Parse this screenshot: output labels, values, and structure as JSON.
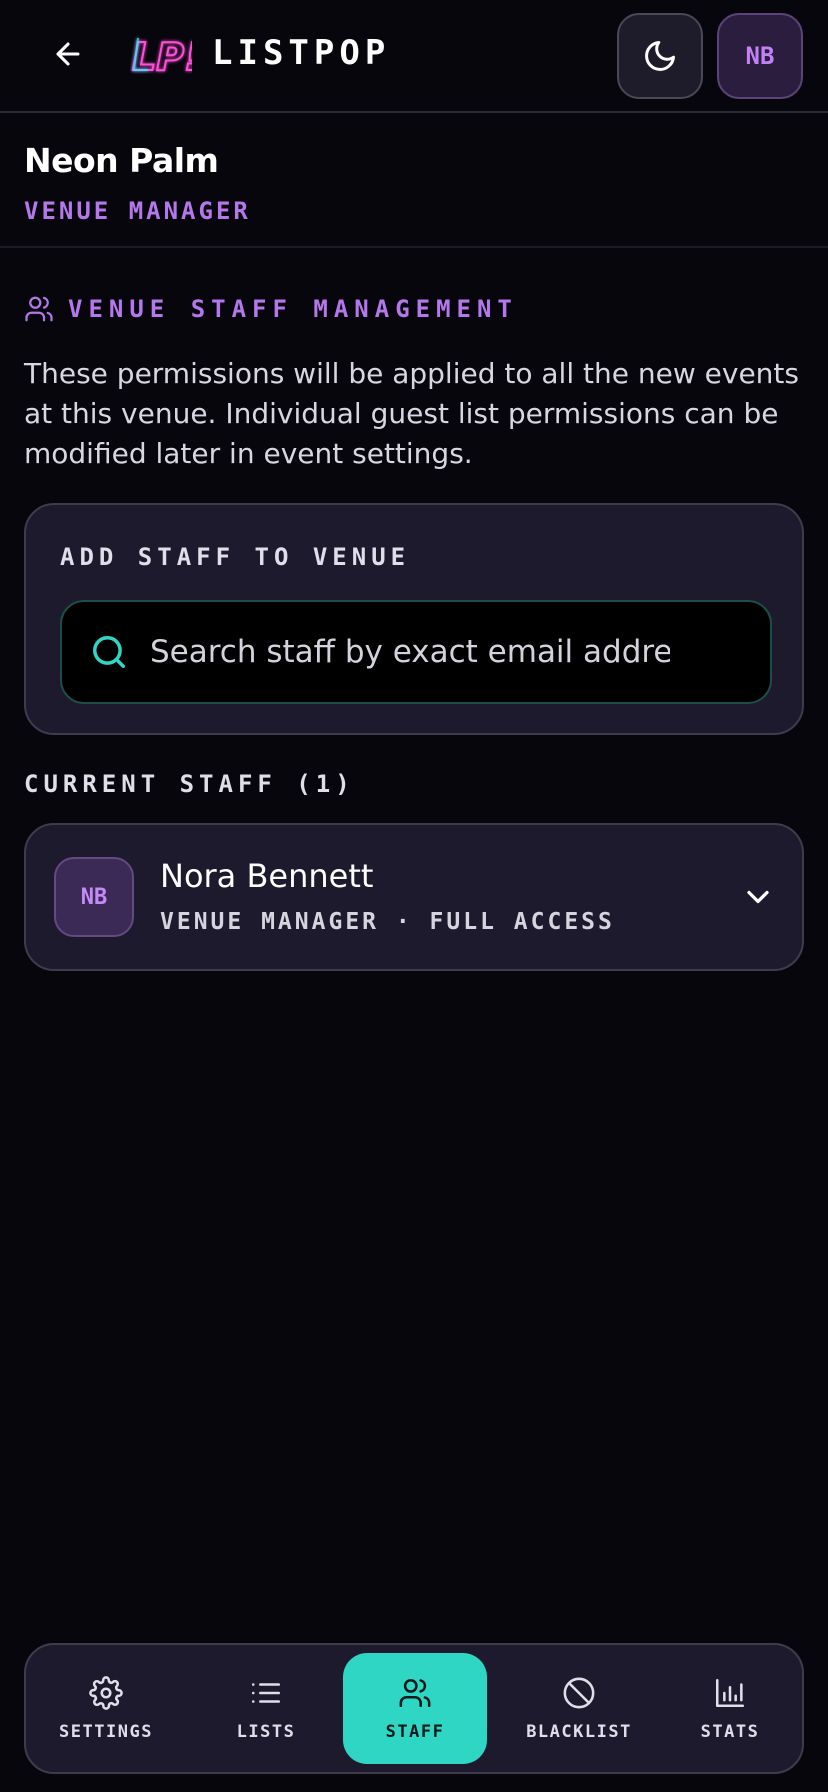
{
  "header": {
    "brand": "LISTPOP",
    "logo_text": "LP!",
    "avatar_initials": "NB"
  },
  "venue": {
    "name": "Neon Palm",
    "role": "VENUE MANAGER"
  },
  "staff_management": {
    "heading": "VENUE STAFF MANAGEMENT",
    "description": "These permissions will be applied to all the new events at this venue. Individual guest list permissions can be modified later in event settings."
  },
  "add_staff": {
    "title": "ADD STAFF TO VENUE",
    "search_placeholder": "Search staff by exact email address",
    "search_value": ""
  },
  "current_staff": {
    "title": "CURRENT STAFF (1)",
    "members": [
      {
        "initials": "NB",
        "name": "Nora Bennett",
        "role": "VENUE MANAGER · FULL ACCESS"
      }
    ]
  },
  "nav": {
    "items": [
      {
        "label": "SETTINGS",
        "icon": "gear-icon"
      },
      {
        "label": "LISTS",
        "icon": "list-icon"
      },
      {
        "label": "STAFF",
        "icon": "users-icon",
        "active": true
      },
      {
        "label": "BLACKLIST",
        "icon": "ban-icon"
      },
      {
        "label": "STATS",
        "icon": "bar-chart-icon"
      }
    ]
  },
  "colors": {
    "background": "#07060c",
    "accent_purple": "#b577ec",
    "accent_teal": "#2fd6c3",
    "card": "#1c1a2c"
  }
}
